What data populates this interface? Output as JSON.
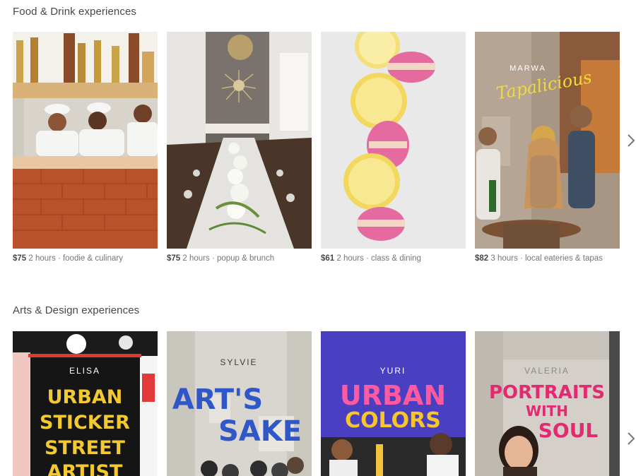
{
  "sections": [
    {
      "title": "Food & Drink experiences",
      "cards": [
        {
          "price": "$75",
          "details": "2 hours · foodie & culinary"
        },
        {
          "price": "$75",
          "details": "2 hours · popup & brunch"
        },
        {
          "price": "$61",
          "details": "2 hours · class & dining"
        },
        {
          "price": "$82",
          "details": "3 hours · local eateries & tapas",
          "host": "MARWA",
          "script": "Tapalicious"
        }
      ]
    },
    {
      "title": "Arts & Design experiences",
      "cards": [
        {
          "host": "ELISA",
          "line1": "URBAN",
          "line2": "STICKER",
          "line3": "STREET",
          "line4": "ARTIST"
        },
        {
          "host": "SYLVIE",
          "line1": "ART'S",
          "line2": "SAKE"
        },
        {
          "host": "YURI",
          "line1": "URBAN",
          "line2": "COLORS"
        },
        {
          "host": "VALERIA",
          "line1": "PORTRAITS",
          "line2": "WITH",
          "line3": "SOUL"
        }
      ]
    }
  ],
  "colors": {
    "heading": "#484848",
    "meta": "#767676",
    "urban_yellow": "#f2c933",
    "sylvie_blue": "#2f57c7",
    "yuri_bg": "#4a3fc0",
    "valeria_pink": "#e3296f"
  }
}
